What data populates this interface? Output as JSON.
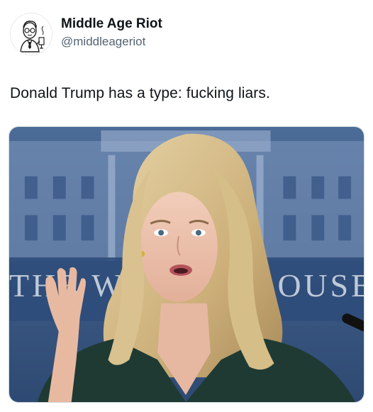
{
  "author": {
    "display_name": "Middle Age Riot",
    "handle": "@middleageriot",
    "avatar_icon": "cartoon-man-avatar-icon"
  },
  "post": {
    "text": "Donald Trump has a type: fucking liars."
  },
  "media": {
    "backdrop_left_text": "TH",
    "backdrop_mid_text": "E W",
    "backdrop_right_text": "OUSE",
    "backdrop_color": "#3f5f8c",
    "hair_color": "#d8c08e",
    "jacket_color": "#1f3a33"
  }
}
